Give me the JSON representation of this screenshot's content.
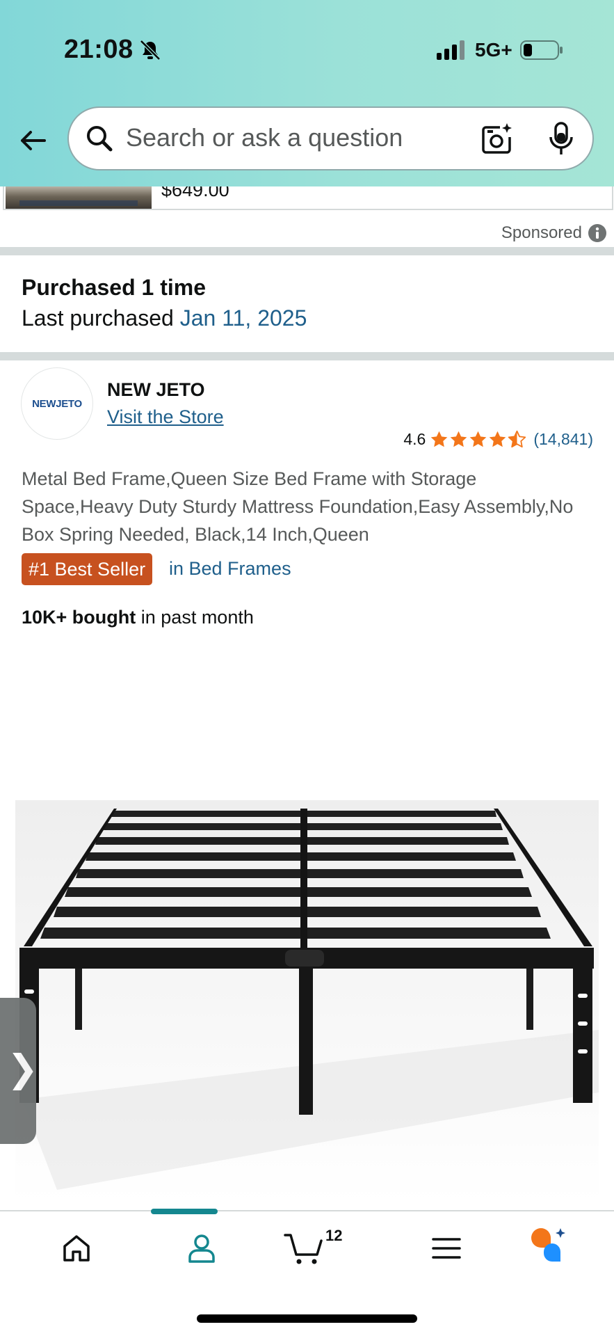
{
  "status_bar": {
    "time": "21:08",
    "network": "5G+"
  },
  "search": {
    "placeholder": "Search or ask a question"
  },
  "sponsored": {
    "price": "$649.00",
    "label": "Sponsored"
  },
  "purchase_history": {
    "count_text": "Purchased 1 time",
    "last_label": "Last purchased",
    "last_date": "Jan 11, 2025"
  },
  "product": {
    "brand_logo_text": "NEWJETO",
    "brand": "NEW JETO",
    "store_link": "Visit the Store",
    "rating": "4.6",
    "rating_stars_value": 4.6,
    "review_count": "(14,841)",
    "title": "Metal Bed Frame,Queen Size Bed Frame with Storage Space,Heavy Duty Sturdy Mattress Foundation,Easy Assembly,No Box Spring Needed, Black,14 Inch,Queen",
    "badge": "#1 Best Seller",
    "badge_category": "in Bed Frames",
    "bought_bold": "10K+ bought",
    "bought_rest": " in past month"
  },
  "side_tab": {
    "glyph": "❯"
  },
  "bottom_nav": {
    "items": [
      "home",
      "account",
      "cart",
      "menu",
      "rufus"
    ],
    "cart_count": "12",
    "active": "account"
  },
  "colors": {
    "link": "#1f5f8b",
    "star": "#f3761a",
    "badge": "#c7511f",
    "nav_active": "#14878f",
    "header_gradient": [
      "#82d7d8",
      "#a5e5d6"
    ]
  }
}
